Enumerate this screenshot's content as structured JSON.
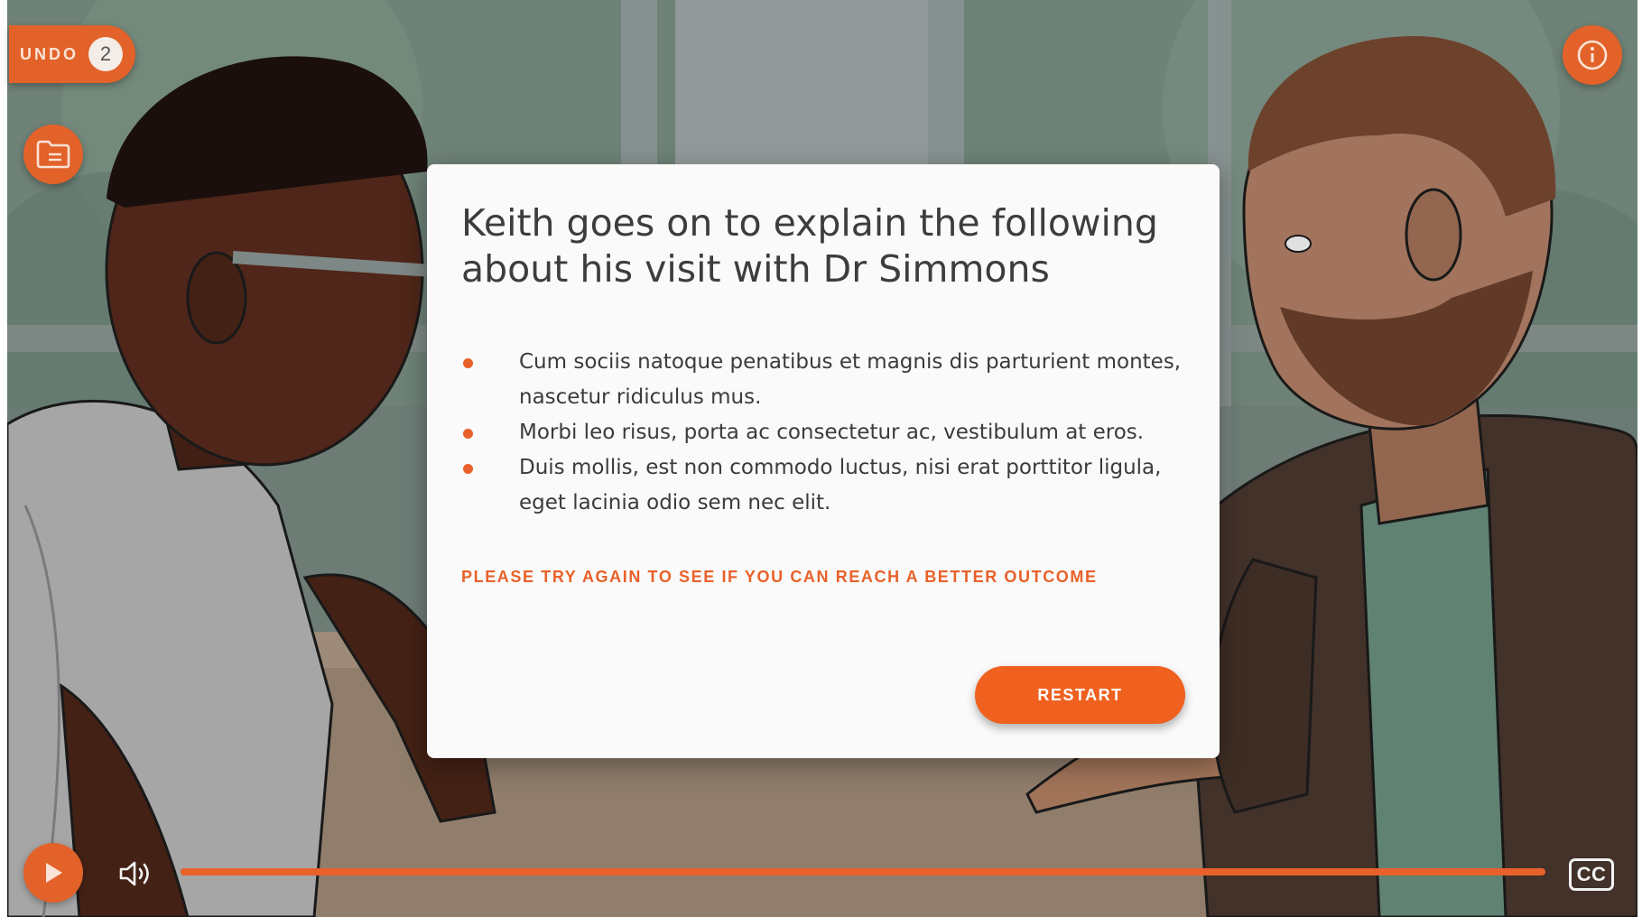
{
  "toolbar": {
    "undo_label": "UNDO",
    "undo_count": "2"
  },
  "modal": {
    "title": "Keith goes on to explain the following about his visit with Dr Simmons",
    "bullets": [
      "Cum sociis natoque penatibus et magnis dis parturient montes, nascetur ridiculus mus.",
      "Morbi leo risus, porta ac consectetur ac, vestibulum at eros.",
      "Duis mollis, est non commodo luctus, nisi erat porttitor ligula, eget lacinia odio sem nec elit."
    ],
    "feedback": "PLEASE TRY AGAIN TO SEE IF YOU CAN REACH A BETTER OUTCOME",
    "restart_label": "RESTART"
  },
  "player": {
    "progress": 1.0,
    "cc_label": "CC"
  },
  "colors": {
    "accent": "#e9612a",
    "button": "#f0601f"
  },
  "icons": {
    "folder": "folder-icon",
    "info": "info-icon",
    "play": "play-icon",
    "volume": "volume-icon"
  }
}
